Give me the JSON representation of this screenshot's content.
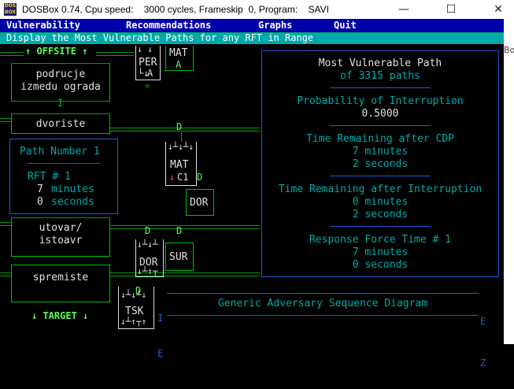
{
  "window": {
    "icon_text": "DOS BOX",
    "title": "DOSBox 0.74, Cpu speed:    3000 cycles, Frameskip  0, Program:    SAVI",
    "minimize": "—",
    "maximize": "☐",
    "close": "✕",
    "side_fragment": "Bo"
  },
  "menu": {
    "items": [
      "Vulnerability",
      "Recommendations",
      "Graphs",
      "Quit"
    ]
  },
  "status": "Display the Most Vulnerable Paths for any RFT in Range",
  "areas": {
    "offsite": "↑ OFFSITE ↑",
    "area1_line1": "podrucje",
    "area1_line2": "izmedu ograda",
    "area2": "dvoriste",
    "area3_line1": "utovar/",
    "area3_line2": "istoavr",
    "area4": "spremiste",
    "target": "↓ TARGET ↓"
  },
  "path_box": {
    "title": "Path Number 1",
    "rft": "RFT # 1",
    "minutes_value": "7",
    "minutes_unit": "minutes",
    "seconds_value": "0",
    "seconds_unit": "seconds"
  },
  "gates": {
    "per": "PER",
    "per_a": "A",
    "mat_top": "MAT",
    "mat_top_a": "A",
    "d_label": "D",
    "mat": "MAT",
    "c1": "C1",
    "dor_side": "DOR",
    "sur": "SUR",
    "dor": "DOR",
    "tsk": "TSK",
    "h_label": "H"
  },
  "panel": {
    "title_line1": "Most Vulnerable Path",
    "title_line2": "of 3315 paths",
    "prob_label": "Probability of Interruption",
    "prob_value": "0.5000",
    "trc_label": "Time Remaining after CDP",
    "trc_min": "7 minutes",
    "trc_sec": "2 seconds",
    "tri_label": "Time Remaining after Interruption",
    "tri_min": "0 minutes",
    "tri_sec": "2 seconds",
    "rft_label": "Response Force Time # 1",
    "rft_min": "7 minutes",
    "rft_sec": "0 seconds"
  },
  "sequence": {
    "left_letters": [
      "I",
      "E"
    ],
    "title": "Generic Adversary Sequence Diagram",
    "right_letters": [
      "E",
      "Z"
    ]
  },
  "colors": {
    "menu_bg": "#0000aa",
    "status_bg": "#00aaaa",
    "green": "#00c000",
    "cyan": "#00aaaa",
    "blue_border": "#2a56d6"
  }
}
